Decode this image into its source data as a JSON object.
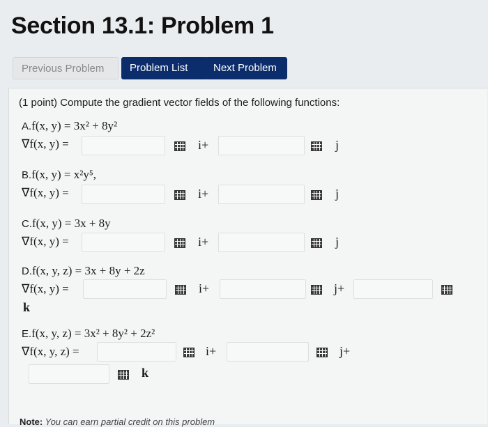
{
  "page": {
    "title": "Section 13.1: Problem 1"
  },
  "nav": {
    "prev_label": "Previous Problem",
    "list_label": "Problem List",
    "next_label": "Next Problem"
  },
  "problem": {
    "intro": "(1 point) Compute the gradient vector fields of the following functions:",
    "parts": [
      {
        "label": "A.",
        "function": "f(x, y) = 3x² + 8y²",
        "gradient": "∇f(x, y) =",
        "units": [
          "i+",
          "j"
        ]
      },
      {
        "label": "B.",
        "function": "f(x, y) = x²y⁵,",
        "gradient": "∇f(x, y) =",
        "units": [
          "i+",
          "j"
        ]
      },
      {
        "label": "C.",
        "function": "f(x, y) = 3x + 8y",
        "gradient": "∇f(x, y) =",
        "units": [
          "i+",
          "j"
        ]
      },
      {
        "label": "D.",
        "function": "f(x, y, z) = 3x + 8y + 2z",
        "gradient": "∇f(x, y) =",
        "units": [
          "i+",
          "j+",
          "k"
        ]
      },
      {
        "label": "E.",
        "function": "f(x, y, z) = 3x² + 8y² + 2z²",
        "gradient": "∇f(x, y, z) =",
        "units": [
          "i+",
          "j+",
          "k"
        ]
      }
    ],
    "note_label": "Note:",
    "note_text": "You can earn partial credit on this problem"
  },
  "colors": {
    "nav_button": "#0c2d6b",
    "disabled_button": "#e6e7e8"
  }
}
